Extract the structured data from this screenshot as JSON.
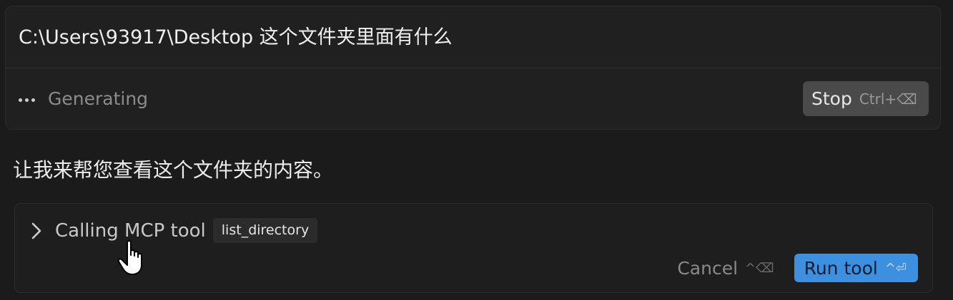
{
  "prompt": {
    "text": "C:\\Users\\93917\\Desktop 这个文件夹里面有什么"
  },
  "status": {
    "icon": "ellipsis-icon",
    "text": "Generating"
  },
  "stop_button": {
    "label": "Stop",
    "shortcut": "Ctrl+⌫"
  },
  "assistant": {
    "message": "让我来帮您查看这个文件夹的内容。"
  },
  "tool_call": {
    "label": "Calling MCP tool",
    "tool_name": "list_directory",
    "cancel_label": "Cancel",
    "cancel_shortcut": "^⌫",
    "run_label": "Run tool",
    "run_shortcut": "^⏎"
  },
  "colors": {
    "background": "#1b1b1b",
    "card": "#202020",
    "accent_blue": "#3d8fe0",
    "stop_button": "#4a4a4a"
  }
}
